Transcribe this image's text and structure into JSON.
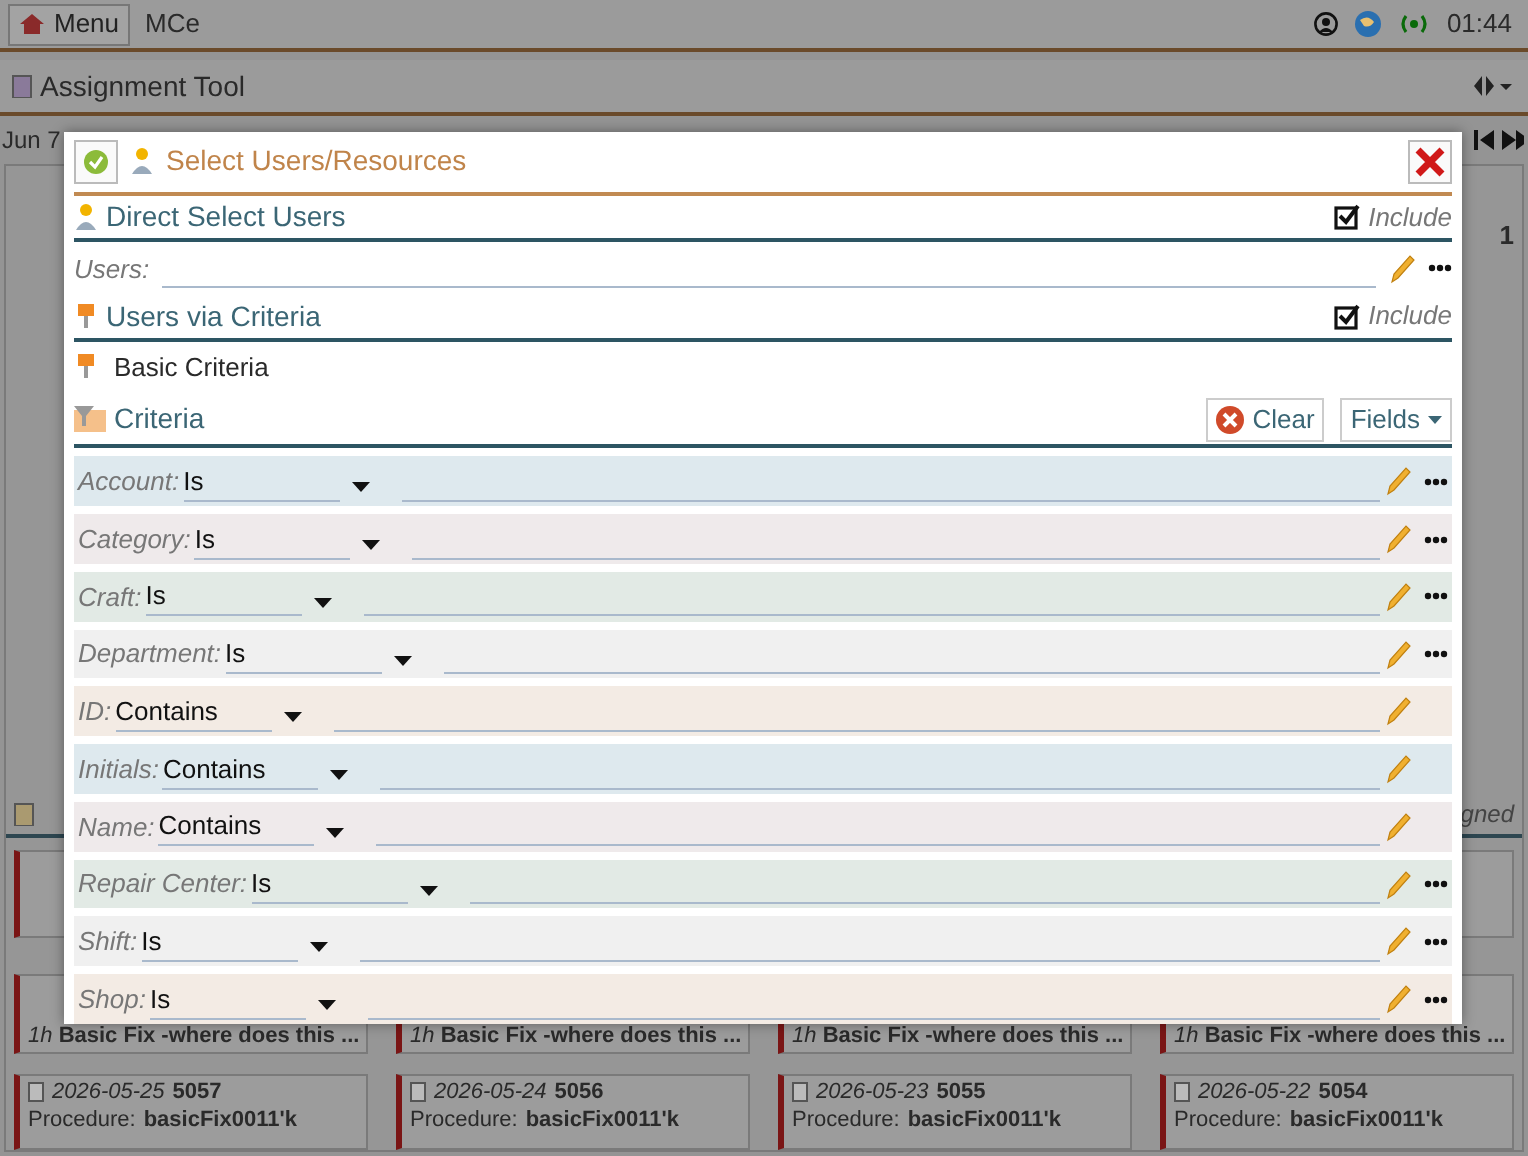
{
  "app_bar": {
    "menu_button": "Menu",
    "app_name": "MCe",
    "clock": "01:44"
  },
  "page_header": {
    "title": "Assignment Tool"
  },
  "date_label": "Jun 7",
  "side_fragments": {
    "count": "1",
    "status": "gned"
  },
  "work_order_titles": [
    {
      "duration": "1h",
      "title": "Basic Fix -where does this ..."
    },
    {
      "duration": "1h",
      "title": "Basic Fix -where does this ..."
    },
    {
      "duration": "1h",
      "title": "Basic Fix -where does this ..."
    },
    {
      "duration": "1h",
      "title": "Basic Fix -where does this ..."
    }
  ],
  "work_orders": [
    {
      "date": "2026-05-25",
      "number": "5057",
      "procedure_label": "Procedure:",
      "procedure": "basicFix0011'k"
    },
    {
      "date": "2026-05-24",
      "number": "5056",
      "procedure_label": "Procedure:",
      "procedure": "basicFix0011'k"
    },
    {
      "date": "2026-05-23",
      "number": "5055",
      "procedure_label": "Procedure:",
      "procedure": "basicFix0011'k"
    },
    {
      "date": "2026-05-22",
      "number": "5054",
      "procedure_label": "Procedure:",
      "procedure": "basicFix0011'k"
    }
  ],
  "dialog": {
    "title": "Select Users/Resources",
    "direct_select": {
      "title": "Direct Select Users",
      "include": {
        "label": "Include",
        "checked": true
      },
      "users_label": "Users:"
    },
    "via_criteria": {
      "title": "Users via Criteria",
      "include": {
        "label": "Include",
        "checked": true
      },
      "basic_criteria": "Basic Criteria",
      "criteria_title": "Criteria",
      "clear_button": "Clear",
      "fields_button": "Fields",
      "rows": [
        {
          "label": "Account:",
          "operator": "Is",
          "color": "#dee9ee",
          "more_button": true
        },
        {
          "label": "Category:",
          "operator": "Is",
          "color": "#efeaeb",
          "more_button": true
        },
        {
          "label": "Craft:",
          "operator": "Is",
          "color": "#e2eae5",
          "more_button": true
        },
        {
          "label": "Department:",
          "operator": "Is",
          "color": "#f0f0f0",
          "more_button": true
        },
        {
          "label": "ID:",
          "operator": "Contains",
          "color": "#f3ebe4",
          "more_button": false
        },
        {
          "label": "Initials:",
          "operator": "Contains",
          "color": "#dee9ee",
          "more_button": false
        },
        {
          "label": "Name:",
          "operator": "Contains",
          "color": "#efeaeb",
          "more_button": false
        },
        {
          "label": "Repair Center:",
          "operator": "Is",
          "color": "#e2eae5",
          "more_button": true
        },
        {
          "label": "Shift:",
          "operator": "Is",
          "color": "#f0f0f0",
          "more_button": true
        },
        {
          "label": "Shop:",
          "operator": "Is",
          "color": "#f3ebe4",
          "more_button": true
        }
      ]
    }
  }
}
